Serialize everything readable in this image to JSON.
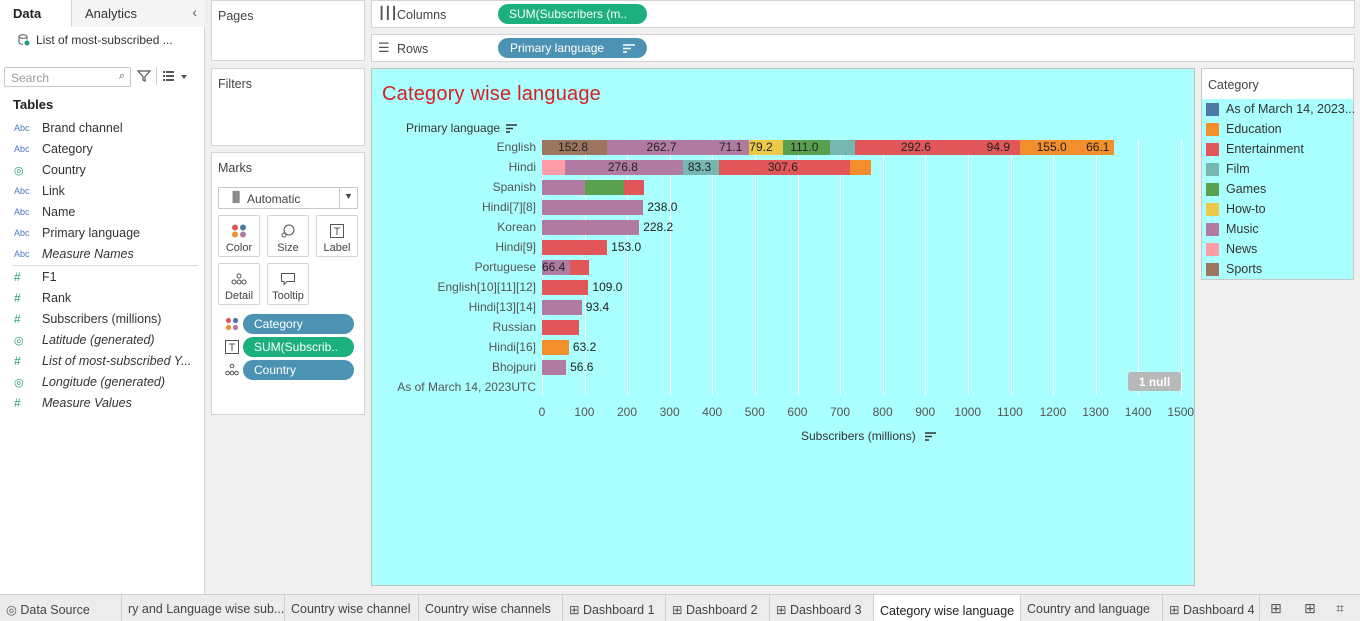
{
  "data_pane": {
    "tab_data": "Data",
    "tab_analytics": "Analytics",
    "datasource": "List of most-subscribed ...",
    "search_placeholder": "Search",
    "tables_title": "Tables",
    "fields": [
      {
        "type": "Abc",
        "name": "Brand channel"
      },
      {
        "type": "Abc",
        "name": "Category"
      },
      {
        "type": "geo",
        "name": "Country"
      },
      {
        "type": "Abc",
        "name": "Link"
      },
      {
        "type": "Abc",
        "name": "Name"
      },
      {
        "type": "Abc",
        "name": "Primary language"
      },
      {
        "type": "Abc",
        "name": "Measure Names"
      },
      {
        "type": "#",
        "name": "F1"
      },
      {
        "type": "#",
        "name": "Rank"
      },
      {
        "type": "#",
        "name": "Subscribers (millions)"
      },
      {
        "type": "geo",
        "name": "Latitude (generated)"
      },
      {
        "type": "#",
        "name": "List of most-subscribed Y..."
      },
      {
        "type": "geo",
        "name": "Longitude (generated)"
      },
      {
        "type": "#",
        "name": "Measure Values"
      }
    ]
  },
  "shelves": {
    "pages": "Pages",
    "filters": "Filters",
    "marks": "Marks",
    "mark_type": "Automatic",
    "columns_label": "Columns",
    "columns_pill": "SUM(Subscribers (m..",
    "rows_label": "Rows",
    "rows_pill": "Primary language",
    "mark_buttons": [
      "Color",
      "Size",
      "Label",
      "Detail",
      "Tooltip"
    ],
    "mark_pills": [
      "Category",
      "SUM(Subscrib..",
      "Country"
    ]
  },
  "chart_data": {
    "type": "bar",
    "orientation": "horizontal-stacked",
    "title": "Category wise language",
    "ylabel": "Primary language",
    "xlabel": "Subscribers (millions)",
    "xlim": [
      0,
      1500
    ],
    "xticks": [
      0,
      100,
      200,
      300,
      400,
      500,
      600,
      700,
      800,
      900,
      1000,
      1100,
      1200,
      1300,
      1400,
      1500
    ],
    "null_badge": "1 null",
    "colors": {
      "As of March 14, 2023UTC": "#4e79a7",
      "Education": "#f28e2b",
      "Entertainment": "#e15759",
      "Film": "#76b7b2",
      "Games": "#59a14f",
      "How-to": "#edc948",
      "Music": "#b07aa1",
      "News": "#ff9da7",
      "Sports": "#9c755f"
    },
    "rows": [
      {
        "label": "English",
        "segments": [
          {
            "cat": "Sports",
            "value": 152.8,
            "label": "152.8"
          },
          {
            "cat": "Music",
            "value": 262.7,
            "label": "262.7"
          },
          {
            "cat": "Music",
            "value": 71.1,
            "label": "71.1"
          },
          {
            "cat": "How-to",
            "value": 79.2,
            "label": "79.2"
          },
          {
            "cat": "Games",
            "value": 111.0,
            "label": "111.0"
          },
          {
            "cat": "Film",
            "value": 58,
            "label": ""
          },
          {
            "cat": "Entertainment",
            "value": 292.6,
            "label": "292.6"
          },
          {
            "cat": "Entertainment",
            "value": 94.9,
            "label": "94.9"
          },
          {
            "cat": "Education",
            "value": 155.0,
            "label": "155.0"
          },
          {
            "cat": "Education",
            "value": 66.1,
            "label": "66.1"
          }
        ]
      },
      {
        "label": "Hindi",
        "segments": [
          {
            "cat": "News",
            "value": 55,
            "label": ""
          },
          {
            "cat": "Music",
            "value": 276.8,
            "label": "276.8"
          },
          {
            "cat": "Film",
            "value": 83.3,
            "label": "83.3"
          },
          {
            "cat": "Entertainment",
            "value": 307.6,
            "label": "307.6"
          },
          {
            "cat": "Education",
            "value": 50,
            "label": ""
          }
        ]
      },
      {
        "label": "Spanish",
        "segments": [
          {
            "cat": "Music",
            "value": 100,
            "label": ""
          },
          {
            "cat": "Games",
            "value": 93,
            "label": ""
          },
          {
            "cat": "Entertainment",
            "value": 46,
            "label": ""
          }
        ]
      },
      {
        "label": "Hindi[7][8]",
        "segments": [
          {
            "cat": "Music",
            "value": 238.0,
            "label": "238.0"
          }
        ]
      },
      {
        "label": "Korean",
        "segments": [
          {
            "cat": "Music",
            "value": 228.2,
            "label": "228.2"
          }
        ]
      },
      {
        "label": "Hindi[9]",
        "segments": [
          {
            "cat": "Entertainment",
            "value": 153.0,
            "label": "153.0"
          }
        ]
      },
      {
        "label": "Portuguese",
        "segments": [
          {
            "cat": "Music",
            "value": 66.4,
            "label": "66.4"
          },
          {
            "cat": "Entertainment",
            "value": 44,
            "label": ""
          }
        ]
      },
      {
        "label": "English[10][11][12]",
        "segments": [
          {
            "cat": "Entertainment",
            "value": 109.0,
            "label": "109.0"
          }
        ]
      },
      {
        "label": "Hindi[13][14]",
        "segments": [
          {
            "cat": "Music",
            "value": 93.4,
            "label": "93.4"
          }
        ]
      },
      {
        "label": "Russian",
        "segments": [
          {
            "cat": "Entertainment",
            "value": 88,
            "label": ""
          }
        ]
      },
      {
        "label": "Hindi[16]",
        "segments": [
          {
            "cat": "Education",
            "value": 63.2,
            "label": "63.2"
          }
        ]
      },
      {
        "label": "Bhojpuri",
        "segments": [
          {
            "cat": "Music",
            "value": 56.6,
            "label": "56.6"
          }
        ]
      },
      {
        "label": "As of March 14, 2023UTC",
        "segments": []
      }
    ]
  },
  "legend": {
    "title": "Category",
    "items": [
      "As of March 14, 2023...",
      "Education",
      "Entertainment",
      "Film",
      "Games",
      "How-to",
      "Music",
      "News",
      "Sports"
    ],
    "colors": [
      "#4e79a7",
      "#f28e2b",
      "#e15759",
      "#76b7b2",
      "#59a14f",
      "#edc948",
      "#b07aa1",
      "#ff9da7",
      "#9c755f"
    ]
  },
  "sheet_tabs": [
    {
      "label": "Data Source",
      "icon": "datasource"
    },
    {
      "label": "ry and Language wise sub...",
      "icon": ""
    },
    {
      "label": "Country wise channel",
      "icon": ""
    },
    {
      "label": "Country wise channels",
      "icon": ""
    },
    {
      "label": "Dashboard 1",
      "icon": "dashboard"
    },
    {
      "label": "Dashboard 2",
      "icon": "dashboard"
    },
    {
      "label": "Dashboard 3",
      "icon": "dashboard"
    },
    {
      "label": "Category wise language",
      "icon": "",
      "active": true
    },
    {
      "label": "Country and language",
      "icon": ""
    },
    {
      "label": "Dashboard 4",
      "icon": "dashboard"
    }
  ]
}
